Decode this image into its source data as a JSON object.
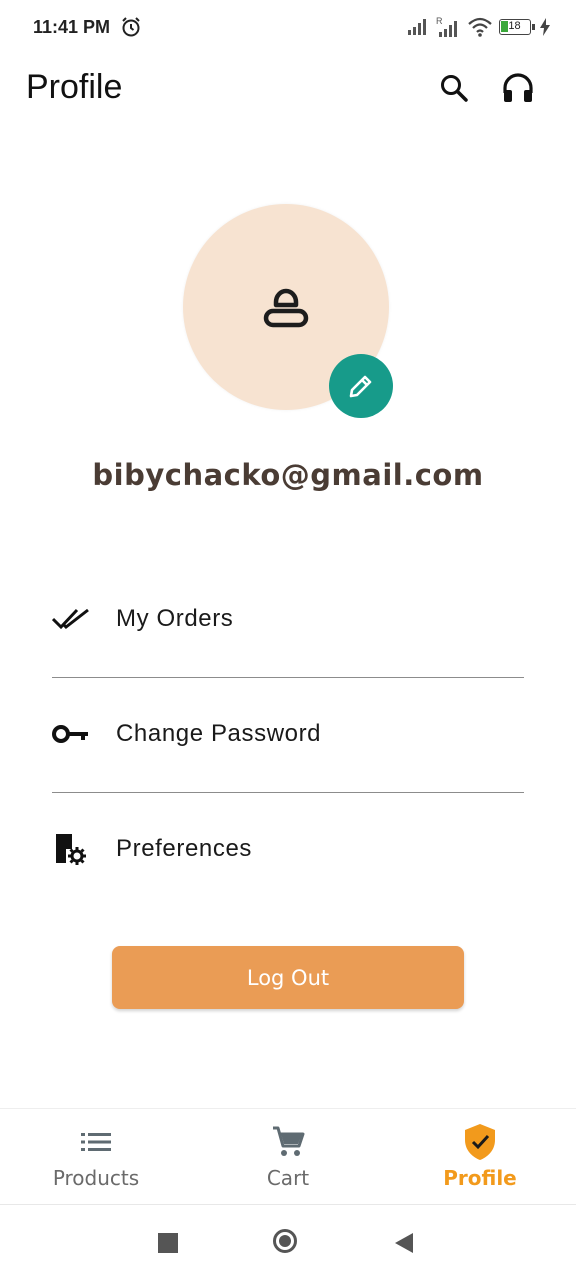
{
  "status": {
    "time": "11:41 PM",
    "battery": "18"
  },
  "header": {
    "title": "Profile"
  },
  "profile": {
    "email": "bibychacko@gmail.com"
  },
  "menu": [
    {
      "label": "My Orders",
      "icon": "double-check-icon"
    },
    {
      "label": "Change Password",
      "icon": "key-icon"
    },
    {
      "label": "Preferences",
      "icon": "preferences-icon"
    }
  ],
  "logout_label": "Log Out",
  "nav": [
    {
      "label": "Products",
      "icon": "list-icon",
      "active": false
    },
    {
      "label": "Cart",
      "icon": "cart-icon",
      "active": false
    },
    {
      "label": "Profile",
      "icon": "shield-check-icon",
      "active": true
    }
  ],
  "colors": {
    "accent": "#f29a1c",
    "button": "#ea9c55",
    "avatar_bg": "#f7e3d1",
    "edit_fab": "#179b8a",
    "email_text": "#4a3c34"
  }
}
